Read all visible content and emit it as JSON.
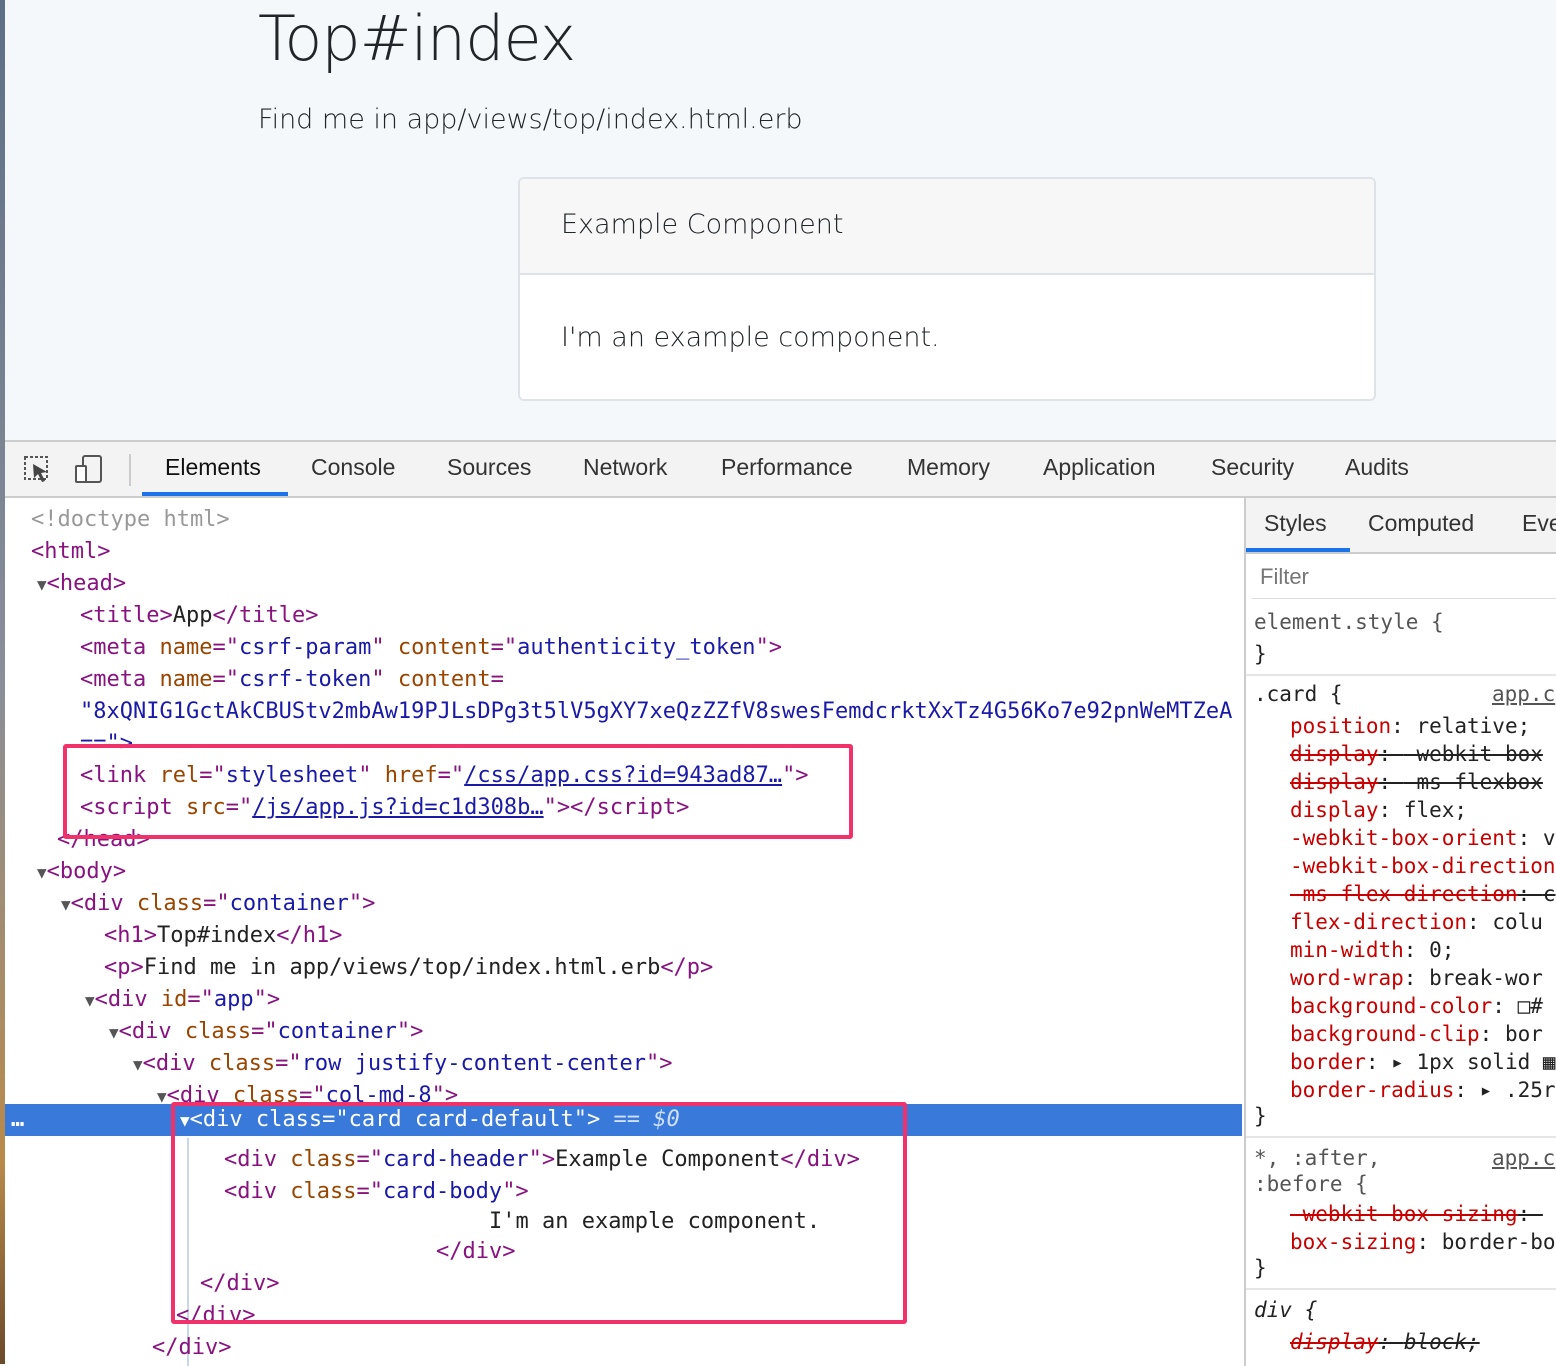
{
  "page": {
    "h1": "Top#index",
    "lead": "Find me in app/views/top/index.html.erb",
    "card_header": "Example Component",
    "card_body": "I'm an example component."
  },
  "devtools": {
    "toolbar_icons": [
      "inspect-arrow-icon",
      "device-toolbar-icon"
    ],
    "tabs": [
      "Elements",
      "Console",
      "Sources",
      "Network",
      "Performance",
      "Memory",
      "Application",
      "Security",
      "Audits"
    ],
    "active_tab": "Elements",
    "accent": "#1a73e8",
    "highlight_box_color": "#f0316a",
    "selected_row_color": "#3879d9",
    "dom": {
      "doctype": "<!doctype html>",
      "html_open": "<html>",
      "head_open": "<head>",
      "title_tag": "title",
      "title_text": "App",
      "meta1_name": "csrf-param",
      "meta1_content": "authenticity_token",
      "meta2_name": "csrf-token",
      "meta2_content_line": "\"8xQNIG1GctAkCBUStv2mbAw19PJLsDPg3t5lV5gXY7xeQzZZfV8swesFemdcrktXxTz4G56Ko7e92pnWeMTZeA",
      "meta2_end": "==\">",
      "link_rel": "stylesheet",
      "link_href": "/css/app.css?id=943ad87…",
      "script_src": "/js/app.js?id=c1d308b…",
      "head_close": "</head>",
      "body_open": "<body>",
      "container_class": "container",
      "h1_text": "Top#index",
      "p_text": "Find me in app/views/top/index.html.erb",
      "app_id": "app",
      "inner_container_class": "container",
      "row_class": "row justify-content-center",
      "col_class": "col-md-8",
      "card_class": "card card-default",
      "selected_marker": "== $0",
      "ellipsis": "…",
      "card_header_class": "card-header",
      "card_header_text": "Example Component",
      "card_body_class": "card-body",
      "card_body_text": "I'm an example component.",
      "div_close": "</div>"
    },
    "styles_panel": {
      "tabs": [
        "Styles",
        "Computed",
        "Eve"
      ],
      "active_tab": "Styles",
      "filter_placeholder": "Filter",
      "element_style": "element.style {",
      "close_brace": "}",
      "card_selector": ".card {",
      "card_source": "app.c",
      "card_props": [
        {
          "name": "position",
          "value": "relative;",
          "struck": false
        },
        {
          "name": "display",
          "value": "-webkit-box",
          "struck": true
        },
        {
          "name": "display",
          "value": "-ms-flexbox",
          "struck": true
        },
        {
          "name": "display",
          "value": "flex;",
          "struck": false
        },
        {
          "name": "-webkit-box-orient",
          "value": "v",
          "struck": false
        },
        {
          "name": "-webkit-box-direction",
          "value": "",
          "struck": false
        },
        {
          "name": "-ms-flex-direction",
          "value": "c",
          "struck": true
        },
        {
          "name": "flex-direction",
          "value": "colu",
          "struck": false
        },
        {
          "name": "min-width",
          "value": "0;",
          "struck": false
        },
        {
          "name": "word-wrap",
          "value": "break-wor",
          "struck": false
        },
        {
          "name": "background-color",
          "value": "□#",
          "struck": false
        },
        {
          "name": "background-clip",
          "value": "bor",
          "struck": false
        },
        {
          "name": "border",
          "value": "▸ 1px solid ▦",
          "struck": false
        },
        {
          "name": "border-radius",
          "value": "▸ .25re",
          "struck": false
        }
      ],
      "universal_selector_1": "*, :after,",
      "universal_selector_2": ":before {",
      "universal_source": "app.c",
      "universal_props": [
        {
          "name": "-webkit-box-sizing",
          "value": "",
          "struck": true
        },
        {
          "name": "box-sizing",
          "value": "border-bo",
          "struck": false
        }
      ],
      "div_selector": "div {",
      "div_prop": {
        "name": "display",
        "value": "block;",
        "struck": true
      }
    }
  }
}
